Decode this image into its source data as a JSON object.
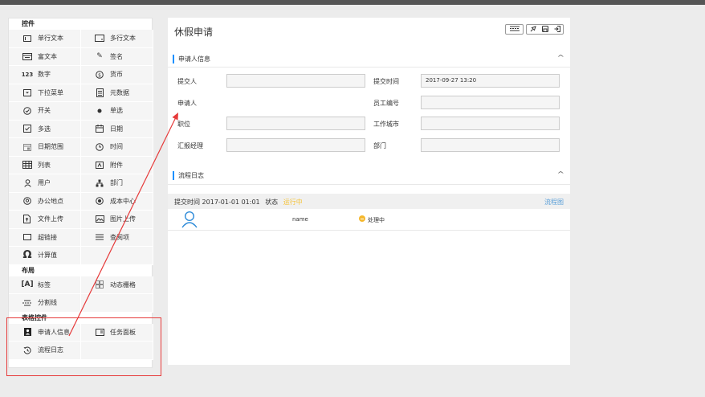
{
  "palette": {
    "sections": [
      {
        "title": "控件",
        "items": [
          {
            "label": "单行文本",
            "icon": "single-line-text-icon"
          },
          {
            "label": "多行文本",
            "icon": "multi-line-text-icon"
          },
          {
            "label": "富文本",
            "icon": "rich-text-icon"
          },
          {
            "label": "签名",
            "icon": "signature-icon"
          },
          {
            "label": "数字",
            "icon": "number-icon"
          },
          {
            "label": "货币",
            "icon": "currency-icon"
          },
          {
            "label": "下拉菜单",
            "icon": "dropdown-icon"
          },
          {
            "label": "元数据",
            "icon": "metadata-icon"
          },
          {
            "label": "开关",
            "icon": "switch-icon"
          },
          {
            "label": "单选",
            "icon": "radio-icon"
          },
          {
            "label": "多选",
            "icon": "checkbox-icon"
          },
          {
            "label": "日期",
            "icon": "calendar-icon"
          },
          {
            "label": "日期范围",
            "icon": "date-range-icon"
          },
          {
            "label": "时间",
            "icon": "clock-icon"
          },
          {
            "label": "列表",
            "icon": "table-icon"
          },
          {
            "label": "附件",
            "icon": "attachment-icon"
          },
          {
            "label": "用户",
            "icon": "user-icon"
          },
          {
            "label": "部门",
            "icon": "department-icon"
          },
          {
            "label": "办公地点",
            "icon": "location-icon"
          },
          {
            "label": "成本中心",
            "icon": "cost-center-icon"
          },
          {
            "label": "文件上传",
            "icon": "file-upload-icon"
          },
          {
            "label": "图片上传",
            "icon": "image-upload-icon"
          },
          {
            "label": "超链接",
            "icon": "hyperlink-icon"
          },
          {
            "label": "查阅项",
            "icon": "lookup-icon"
          },
          {
            "label": "计算值",
            "icon": "omega-icon"
          }
        ]
      },
      {
        "title": "布局",
        "items": [
          {
            "label": "标签",
            "icon": "label-icon"
          },
          {
            "label": "动态栅格",
            "icon": "dynamic-grid-icon"
          },
          {
            "label": "分割线",
            "icon": "divider-icon"
          }
        ]
      },
      {
        "title": "表格控件",
        "items": [
          {
            "label": "申请人信息",
            "icon": "applicant-info-icon"
          },
          {
            "label": "任务面板",
            "icon": "task-panel-icon"
          },
          {
            "label": "流程日志",
            "icon": "process-log-icon"
          }
        ]
      }
    ]
  },
  "form": {
    "title": "休假申请",
    "toolbar": [
      {
        "name": "layout-button",
        "glyph": "⊞"
      },
      {
        "name": "pin-button",
        "glyph": "✎"
      },
      {
        "name": "save-button",
        "glyph": "▣"
      },
      {
        "name": "export-button",
        "glyph": "⇥"
      }
    ],
    "applicant_section": {
      "title": "申请人信息",
      "fields": {
        "submitter": {
          "label": "提交人",
          "value": ""
        },
        "submit_time": {
          "label": "提交时间",
          "value": "2017-09-27 13:20"
        },
        "applicant": {
          "label": "申请人"
        },
        "employee_no": {
          "label": "员工编号",
          "value": ""
        },
        "position": {
          "label": "职位",
          "value": ""
        },
        "work_city": {
          "label": "工作城市",
          "value": ""
        },
        "manager": {
          "label": "汇报经理",
          "value": ""
        },
        "department": {
          "label": "部门",
          "value": ""
        }
      }
    },
    "log_section": {
      "title": "流程日志",
      "submit_label": "提交时间",
      "submit_time": "2017-01-01 01:01",
      "status_label": "状态",
      "status_value": "运行中",
      "flow_link": "流程图",
      "entry": {
        "name": "name",
        "status": "处理中"
      }
    }
  },
  "colors": {
    "accent": "#1890ff",
    "annotation": "#e63a3a",
    "running": "#f5c33b",
    "link": "#5a9fd8"
  }
}
